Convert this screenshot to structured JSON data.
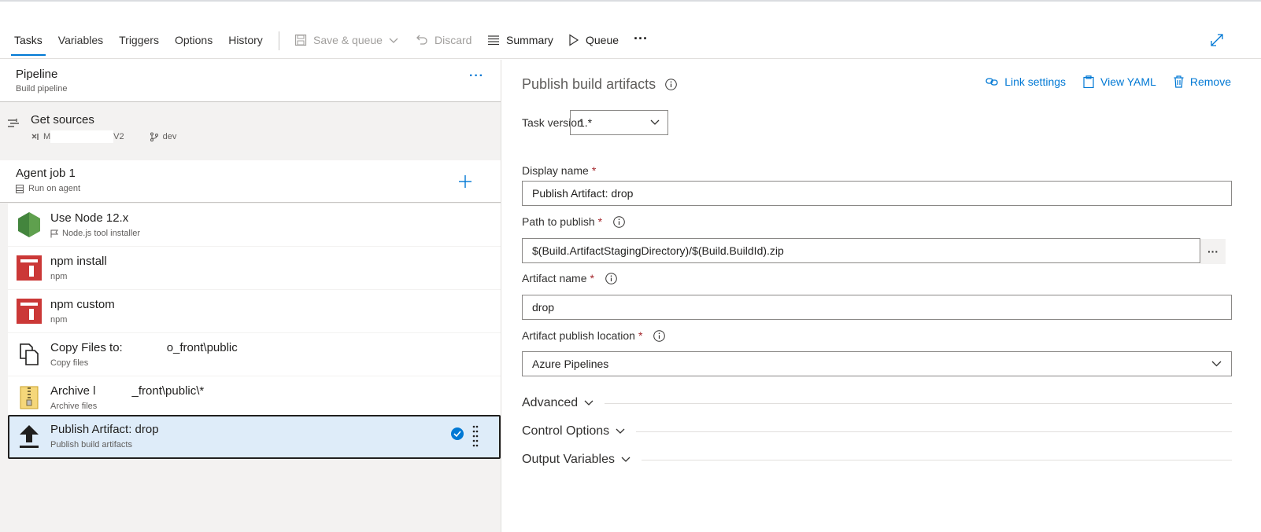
{
  "toolbar": {
    "tabs": [
      "Tasks",
      "Variables",
      "Triggers",
      "Options",
      "History"
    ],
    "save_queue": "Save & queue",
    "discard": "Discard",
    "summary": "Summary",
    "queue": "Queue",
    "more": "···"
  },
  "pipeline": {
    "title": "Pipeline",
    "subtitle": "Build pipeline",
    "more": "···"
  },
  "get_sources": {
    "title": "Get sources",
    "repo_start": "M",
    "repo_end": "V2",
    "branch": "dev"
  },
  "agent_job": {
    "title": "Agent job 1",
    "subtitle": "Run on agent"
  },
  "tasks": [
    {
      "name": "Use Node 12.x",
      "desc": "Node.js tool installer"
    },
    {
      "name": "npm install",
      "desc": "npm"
    },
    {
      "name": "npm custom",
      "desc": "npm"
    },
    {
      "name_start": "Copy Files to:",
      "name_end": "o_front\\public",
      "desc": "Copy files"
    },
    {
      "name_start": "Archive l",
      "name_end": "_front\\public\\*",
      "desc": "Archive files"
    },
    {
      "name": "Publish Artifact: drop",
      "desc": "Publish build artifacts"
    }
  ],
  "details": {
    "title": "Publish build artifacts",
    "links": {
      "link_settings": "Link settings",
      "view_yaml": "View YAML",
      "remove": "Remove"
    },
    "task_version_label": "Task version",
    "task_version_value": "1.*",
    "display_name_label": "Display name",
    "display_name_value": "Publish Artifact: drop",
    "path_label": "Path to publish",
    "path_value": "$(Build.ArtifactStagingDirectory)/$(Build.BuildId).zip",
    "browse": "···",
    "artifact_name_label": "Artifact name",
    "artifact_name_value": "drop",
    "publish_location_label": "Artifact publish location",
    "publish_location_value": "Azure Pipelines",
    "required_mark": "*",
    "sections": [
      "Advanced",
      "Control Options",
      "Output Variables"
    ]
  },
  "colors": {
    "accent": "#0078d4",
    "npm_red": "#cb3837",
    "node_green": "#43853d",
    "selected_bg": "#deecf9"
  }
}
